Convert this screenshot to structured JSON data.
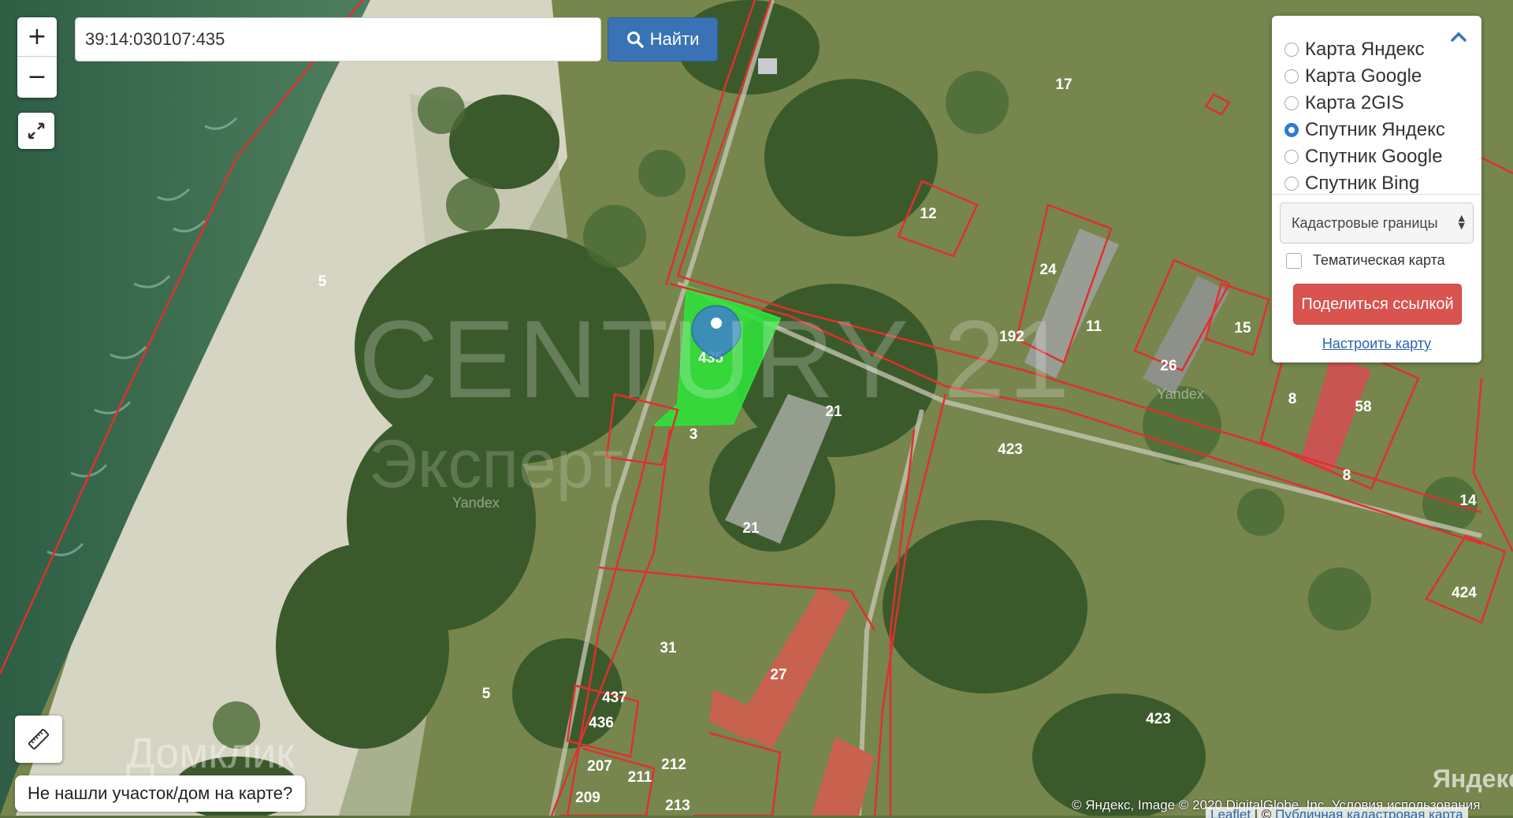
{
  "search": {
    "value": "39:14:030107:435",
    "button_label": "Найти"
  },
  "layers": {
    "options": [
      {
        "label": "Карта Яндекс",
        "selected": false
      },
      {
        "label": "Карта Google",
        "selected": false
      },
      {
        "label": "Карта 2GIS",
        "selected": false
      },
      {
        "label": "Спутник Яндекс",
        "selected": true
      },
      {
        "label": "Спутник Google",
        "selected": false
      },
      {
        "label": "Спутник Bing",
        "selected": false
      }
    ],
    "overlay_select": "Кадастровые границы",
    "thematic_label": "Тематическая карта",
    "thematic_checked": false,
    "share_label": "Поделиться ссылкой",
    "settings_link": "Настроить карту"
  },
  "not_found": "Не нашли участок/дом на карте?",
  "watermarks": {
    "century": "CENTURY 21",
    "expert": "Эксперт",
    "domclick": "Домклик",
    "yandex_logo": "Яндекс",
    "yandex_small": "Yandex"
  },
  "attribution": {
    "imagery": "© Яндекс, Image © 2020 DigitalGlobe, Inc. Условия использования",
    "leaflet": "Leaflet",
    "pkk": "Публичная кадастровая карта"
  },
  "parcel_labels": [
    "435",
    "3",
    "21",
    "21",
    "17",
    "12",
    "24",
    "192",
    "11",
    "26",
    "15",
    "8",
    "58",
    "8",
    "423",
    "14",
    "424",
    "5",
    "5",
    "31",
    "27",
    "437",
    "436",
    "207",
    "211",
    "212",
    "209",
    "213",
    "423"
  ],
  "colors": {
    "boundary": "#e03030",
    "selected_parcel": "#2fe03a",
    "marker": "#3f82cc",
    "forest": "#3d5a2c",
    "grass": "#7f8f52",
    "sea": "#3a6b4a",
    "sand": "#d8d6c8"
  }
}
